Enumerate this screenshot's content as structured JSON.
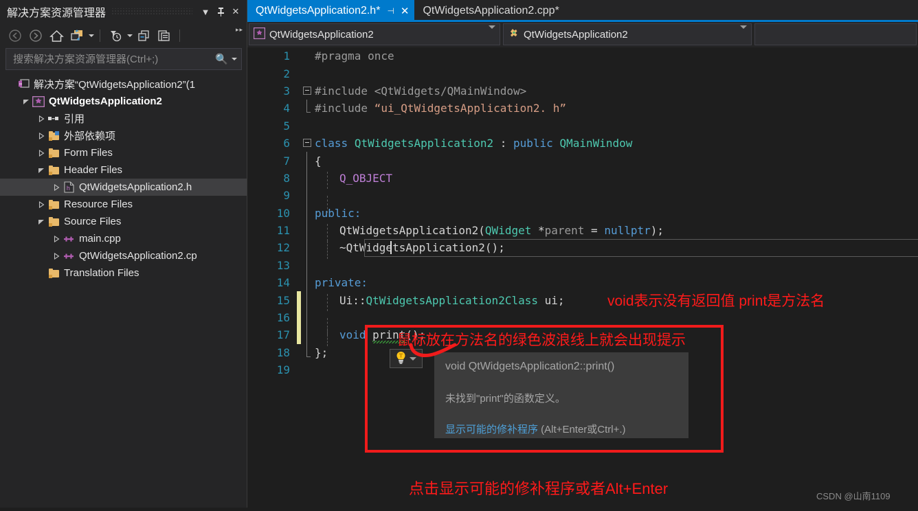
{
  "solution_explorer": {
    "title": "解决方案资源管理器",
    "header_buttons": [
      {
        "name": "dropdown",
        "glyph": "▼"
      },
      {
        "name": "pin",
        "glyph": "⚲"
      },
      {
        "name": "close",
        "glyph": "✕"
      }
    ],
    "toolbar": [
      {
        "name": "back",
        "glyph": "◀"
      },
      {
        "name": "forward",
        "glyph": "▶"
      },
      {
        "name": "home",
        "glyph": "⌂"
      },
      {
        "name": "sync-with-active-document",
        "glyph": "▣"
      },
      {
        "name": "pending-changes-filter",
        "glyph": "◷"
      },
      {
        "name": "show-all-files",
        "glyph": "❐"
      },
      {
        "name": "properties",
        "glyph": "🗎"
      }
    ],
    "search_placeholder": "搜索解决方案资源管理器(Ctrl+;)",
    "tree": [
      {
        "label": "解决方案“QtWidgetsApplication2”(1",
        "indent": 0,
        "twisty": "none",
        "icon": "solution",
        "bold": false
      },
      {
        "label": "QtWidgetsApplication2",
        "indent": 1,
        "twisty": "expanded",
        "icon": "project",
        "bold": true
      },
      {
        "label": "引用",
        "indent": 2,
        "twisty": "collapsed",
        "icon": "references",
        "bold": false
      },
      {
        "label": "外部依赖项",
        "indent": 2,
        "twisty": "collapsed",
        "icon": "ext-folder",
        "bold": false
      },
      {
        "label": "Form Files",
        "indent": 2,
        "twisty": "collapsed",
        "icon": "folder",
        "bold": false
      },
      {
        "label": "Header Files",
        "indent": 2,
        "twisty": "expanded",
        "icon": "folder-open",
        "bold": false
      },
      {
        "label": "QtWidgetsApplication2.h",
        "indent": 3,
        "twisty": "collapsed",
        "icon": "header-file",
        "bold": false,
        "selected": true
      },
      {
        "label": "Resource Files",
        "indent": 2,
        "twisty": "collapsed",
        "icon": "folder",
        "bold": false
      },
      {
        "label": "Source Files",
        "indent": 2,
        "twisty": "expanded",
        "icon": "folder-open",
        "bold": false
      },
      {
        "label": "main.cpp",
        "indent": 3,
        "twisty": "collapsed",
        "icon": "cpp-file",
        "bold": false
      },
      {
        "label": "QtWidgetsApplication2.cp",
        "indent": 3,
        "twisty": "collapsed",
        "icon": "cpp-file",
        "bold": false
      },
      {
        "label": "Translation Files",
        "indent": 2,
        "twisty": "none",
        "icon": "folder",
        "bold": false
      }
    ]
  },
  "tabs": [
    {
      "label": "QtWidgetsApplication2.h*",
      "active": true,
      "pin_glyph": "⊣",
      "close_glyph": "✕"
    },
    {
      "label": "QtWidgetsApplication2.cpp*",
      "active": false
    }
  ],
  "navbar": {
    "project_selector": "QtWidgetsApplication2",
    "type_selector": "QtWidgetsApplication2",
    "member_selector": ""
  },
  "code": {
    "lines": [
      {
        "n": "1",
        "indent": 0,
        "change": false
      },
      {
        "n": "2",
        "indent": 0,
        "change": false
      },
      {
        "n": "3",
        "indent": 0,
        "change": false
      },
      {
        "n": "4",
        "indent": 0,
        "change": false
      },
      {
        "n": "5",
        "indent": 0,
        "change": false
      },
      {
        "n": "6",
        "indent": 0,
        "change": false
      },
      {
        "n": "7",
        "indent": 0,
        "change": false
      },
      {
        "n": "8",
        "indent": 0,
        "change": false
      },
      {
        "n": "9",
        "indent": 0,
        "change": false
      },
      {
        "n": "10",
        "indent": 0,
        "change": false
      },
      {
        "n": "11",
        "indent": 0,
        "change": false
      },
      {
        "n": "12",
        "indent": 0,
        "change": false
      },
      {
        "n": "13",
        "indent": 0,
        "change": false
      },
      {
        "n": "14",
        "indent": 0,
        "change": false
      },
      {
        "n": "15",
        "indent": 0,
        "change": true
      },
      {
        "n": "16",
        "indent": 0,
        "change": true
      },
      {
        "n": "17",
        "indent": 0,
        "change": true
      },
      {
        "n": "18",
        "indent": 0,
        "change": false
      },
      {
        "n": "19",
        "indent": 0,
        "change": false
      }
    ],
    "text": {
      "l1": "#pragma once",
      "l3_kw": "#include",
      "l3_inc": "<QtWidgets/QMainWindow>",
      "l4_kw": "#include",
      "l4_inc": "“ui_QtWidgetsApplication2. h”",
      "l6_class": "class",
      "l6_name": "QtWidgetsApplication2",
      "l6_colon": " : ",
      "l6_public": "public",
      "l6_base": "QMainWindow",
      "l7": "{",
      "l8": "Q_OBJECT",
      "l10": "public:",
      "l11_a": "QtWidgetsApplication2(",
      "l11_b": "QWidget",
      "l11_c": " *",
      "l11_d": "parent",
      "l11_e": " = ",
      "l11_f": "nullptr",
      "l11_g": ");",
      "l12": "~QtWidgetsApplication2();",
      "l14": "private:",
      "l15_a": "Ui::",
      "l15_b": "QtWidgetsApplication2Class",
      "l15_c": " ui;",
      "l17_void": "void",
      "l17_name": "print",
      "l17_tail": "();",
      "l18": "};"
    }
  },
  "tooltip": {
    "signature": "void QtWidgetsApplication2::print()",
    "message": "未找到\"print\"的函数定义。",
    "fix_link": "显示可能的修补程序",
    "fix_shortcut": " (Alt+Enter或Ctrl+.)",
    "bulb_glyph": "💡"
  },
  "annotations": {
    "top_right": "void表示没有返回值  print是方法名",
    "middle": "鼠标放在方法名的绿色波浪线上就会出现提示",
    "bottom": "点击显示可能的修补程序或者Alt+Enter",
    "watermark": "CSDN @山南1109"
  },
  "colors": {
    "accent": "#007acc",
    "annotation_red": "#ff1a1a",
    "change_bar": "#e8e6a0",
    "keyword": "#569cd6",
    "type": "#4ec9b0",
    "string": "#d69d85",
    "macro": "#be7fd6",
    "line_number": "#2b91af"
  }
}
